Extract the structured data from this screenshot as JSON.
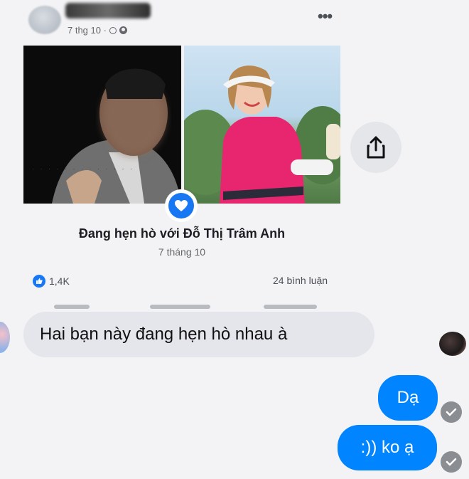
{
  "post": {
    "meta_date": "7 thg 10 ·",
    "relationship_title": "Đang hẹn hò với Đỗ Thị Trâm Anh",
    "relationship_date": "7 tháng 10",
    "likes": "1,4K",
    "comments": "24 bình luận"
  },
  "messages": {
    "incoming": "Hai bạn này đang hẹn hò nhau à",
    "outgoing": [
      "Dạ",
      ":)) ko ạ"
    ]
  },
  "colors": {
    "messenger_blue": "#0084ff",
    "facebook_blue": "#1877f2",
    "bubble_gray": "#e4e6eb"
  },
  "icons": [
    "more-icon",
    "clock-icon",
    "globe-icon",
    "share-icon",
    "heart-badge-icon",
    "like-icon",
    "seen-check-icon"
  ]
}
